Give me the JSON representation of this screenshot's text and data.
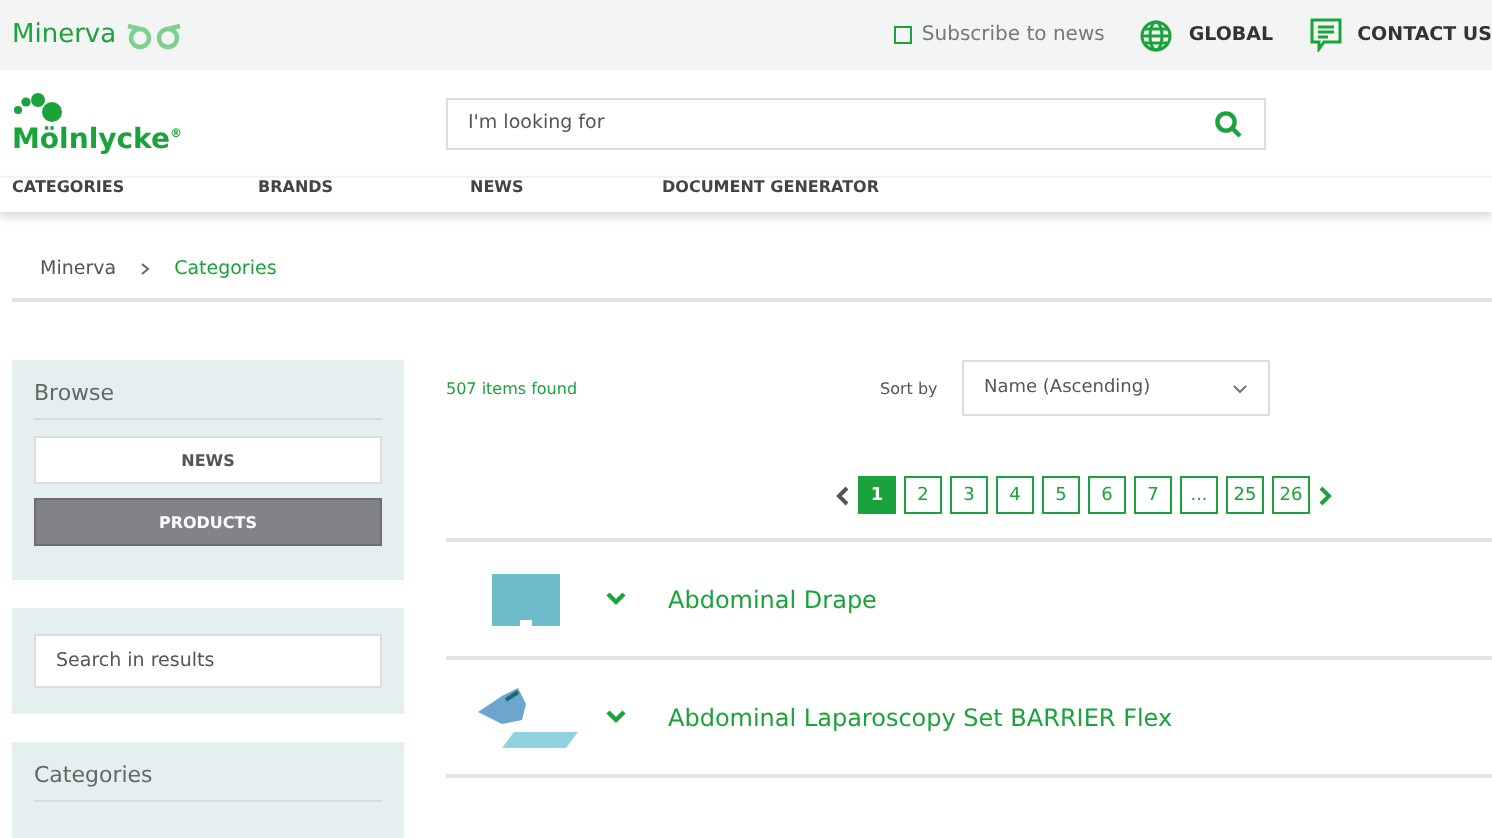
{
  "top_bar": {
    "site_name": "Minerva",
    "subscribe": {
      "label": "Subscribe to news",
      "checked": false
    },
    "region": "GLOBAL",
    "contact": "CONTACT US"
  },
  "header": {
    "logo_text": "Mölnlycke",
    "logo_mark": "®",
    "search": {
      "placeholder": "I'm looking for"
    }
  },
  "nav": [
    "CATEGORIES",
    "BRANDS",
    "NEWS",
    "DOCUMENT GENERATOR"
  ],
  "breadcrumb": [
    {
      "label": "Minerva",
      "current": false
    },
    {
      "label": "Categories",
      "current": true
    }
  ],
  "sidebar": {
    "browse": {
      "title": "Browse",
      "items": [
        {
          "label": "NEWS",
          "selected": false
        },
        {
          "label": "PRODUCTS",
          "selected": true
        }
      ]
    },
    "search": {
      "placeholder": "Search in results"
    },
    "categories": {
      "title": "Categories"
    }
  },
  "results": {
    "count": "507 items found",
    "sort_label": "Sort by",
    "sort_value": "Name (Ascending)",
    "pages": [
      {
        "label": "1",
        "selected": true
      },
      {
        "label": "2",
        "selected": false
      },
      {
        "label": "3",
        "selected": false
      },
      {
        "label": "4",
        "selected": false
      },
      {
        "label": "5",
        "selected": false
      },
      {
        "label": "6",
        "selected": false
      },
      {
        "label": "7",
        "selected": false
      },
      {
        "label": "...",
        "selected": false
      },
      {
        "label": "25",
        "selected": false
      },
      {
        "label": "26",
        "selected": false
      }
    ],
    "items": [
      {
        "name": "Abdominal Drape",
        "kind": "drape"
      },
      {
        "name": "Abdominal Laparoscopy Set BARRIER Flex",
        "kind": "set"
      }
    ]
  }
}
